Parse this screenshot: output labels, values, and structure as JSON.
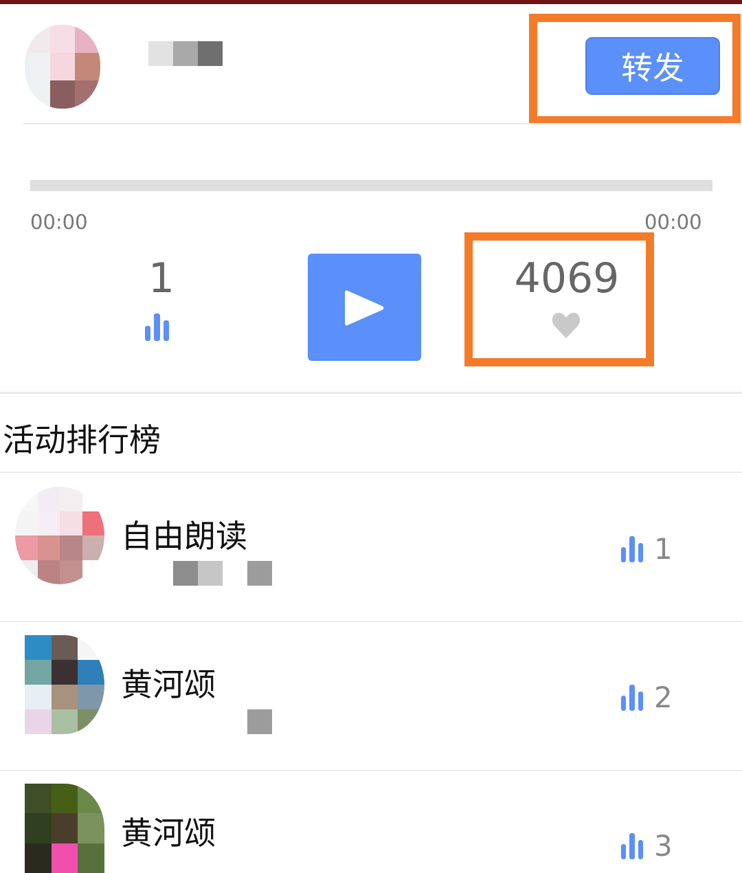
{
  "header": {
    "share_label": "转发"
  },
  "player": {
    "time_current": "00:00",
    "time_total": "00:00",
    "progress": 0,
    "play_count": "1",
    "like_count": "4069"
  },
  "ranking": {
    "title": "活动排行榜",
    "items": [
      {
        "title": "自由朗读",
        "count": "1"
      },
      {
        "title": "黄河颂",
        "count": "2"
      },
      {
        "title": "黄河颂",
        "count": "3"
      }
    ]
  },
  "colors": {
    "accent": "#5b8ff9",
    "highlight": "#f47b2a",
    "topbar": "#6e1414"
  },
  "icons": [
    "bar-chart-icon",
    "play-icon",
    "heart-icon"
  ]
}
